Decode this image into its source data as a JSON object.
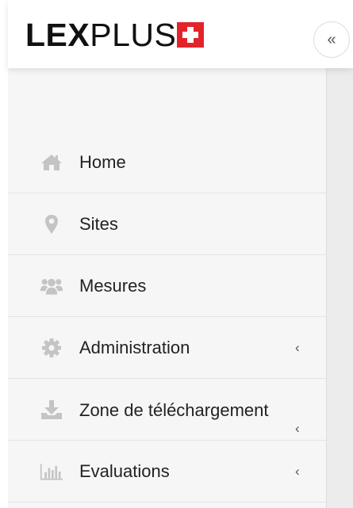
{
  "brand": {
    "logo_bold": "LEX",
    "logo_thin": "PLUS"
  },
  "header": {
    "collapse_label": "«"
  },
  "nav": {
    "items": [
      {
        "label": "Home",
        "icon": "home-icon",
        "has_chevron": false
      },
      {
        "label": "Sites",
        "icon": "map-marker-icon",
        "has_chevron": false
      },
      {
        "label": "Mesures",
        "icon": "users-icon",
        "has_chevron": false
      },
      {
        "label": "Administration",
        "icon": "gear-icon",
        "has_chevron": true,
        "chevron": "‹"
      },
      {
        "label": "Zone de téléchargement",
        "icon": "download-icon",
        "has_chevron": true,
        "chevron": "‹"
      },
      {
        "label": "Evaluations",
        "icon": "bar-chart-icon",
        "has_chevron": true,
        "chevron": "‹"
      }
    ]
  },
  "colors": {
    "icon_gray": "#c4c4c4",
    "accent_red": "#e3232a",
    "sidebar_bg": "#f6f6f6"
  }
}
